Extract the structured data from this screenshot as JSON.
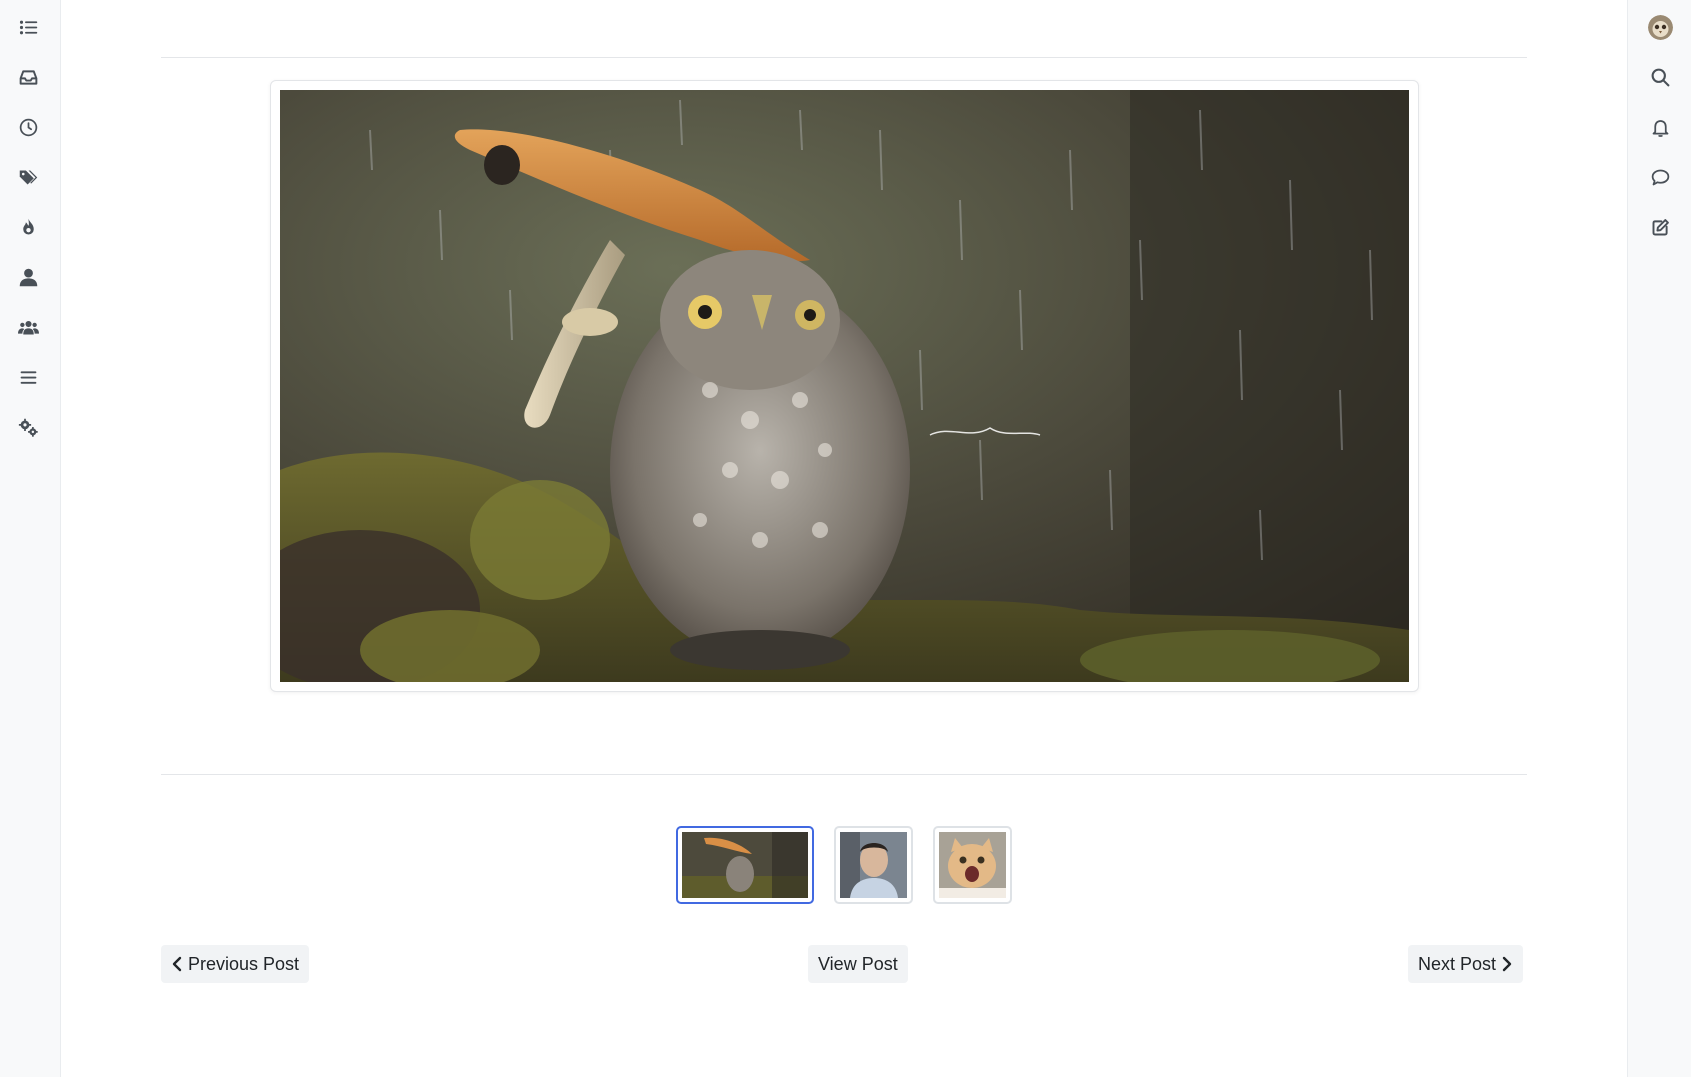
{
  "left_nav": {
    "items": [
      {
        "icon": "list-icon"
      },
      {
        "icon": "inbox-icon"
      },
      {
        "icon": "clock-icon"
      },
      {
        "icon": "tags-icon"
      },
      {
        "icon": "fire-icon"
      },
      {
        "icon": "user-icon"
      },
      {
        "icon": "users-icon"
      },
      {
        "icon": "menu-icon"
      },
      {
        "icon": "cogs-icon"
      }
    ]
  },
  "right_nav": {
    "items": [
      {
        "icon": "avatar"
      },
      {
        "icon": "search-icon"
      },
      {
        "icon": "bell-icon"
      },
      {
        "icon": "chat-icon"
      },
      {
        "icon": "compose-icon"
      }
    ]
  },
  "gallery": {
    "thumbnails": [
      {
        "subject": "owl under mushroom",
        "active": true
      },
      {
        "subject": "man portrait",
        "active": false
      },
      {
        "subject": "surprised cat",
        "active": false
      }
    ]
  },
  "navigation": {
    "previous_label": "Previous Post",
    "view_label": "View Post",
    "next_label": "Next Post"
  },
  "colors": {
    "accent": "#4169e1",
    "sidebar_bg": "#f8f9fa",
    "button_bg": "#f1f3f5"
  }
}
